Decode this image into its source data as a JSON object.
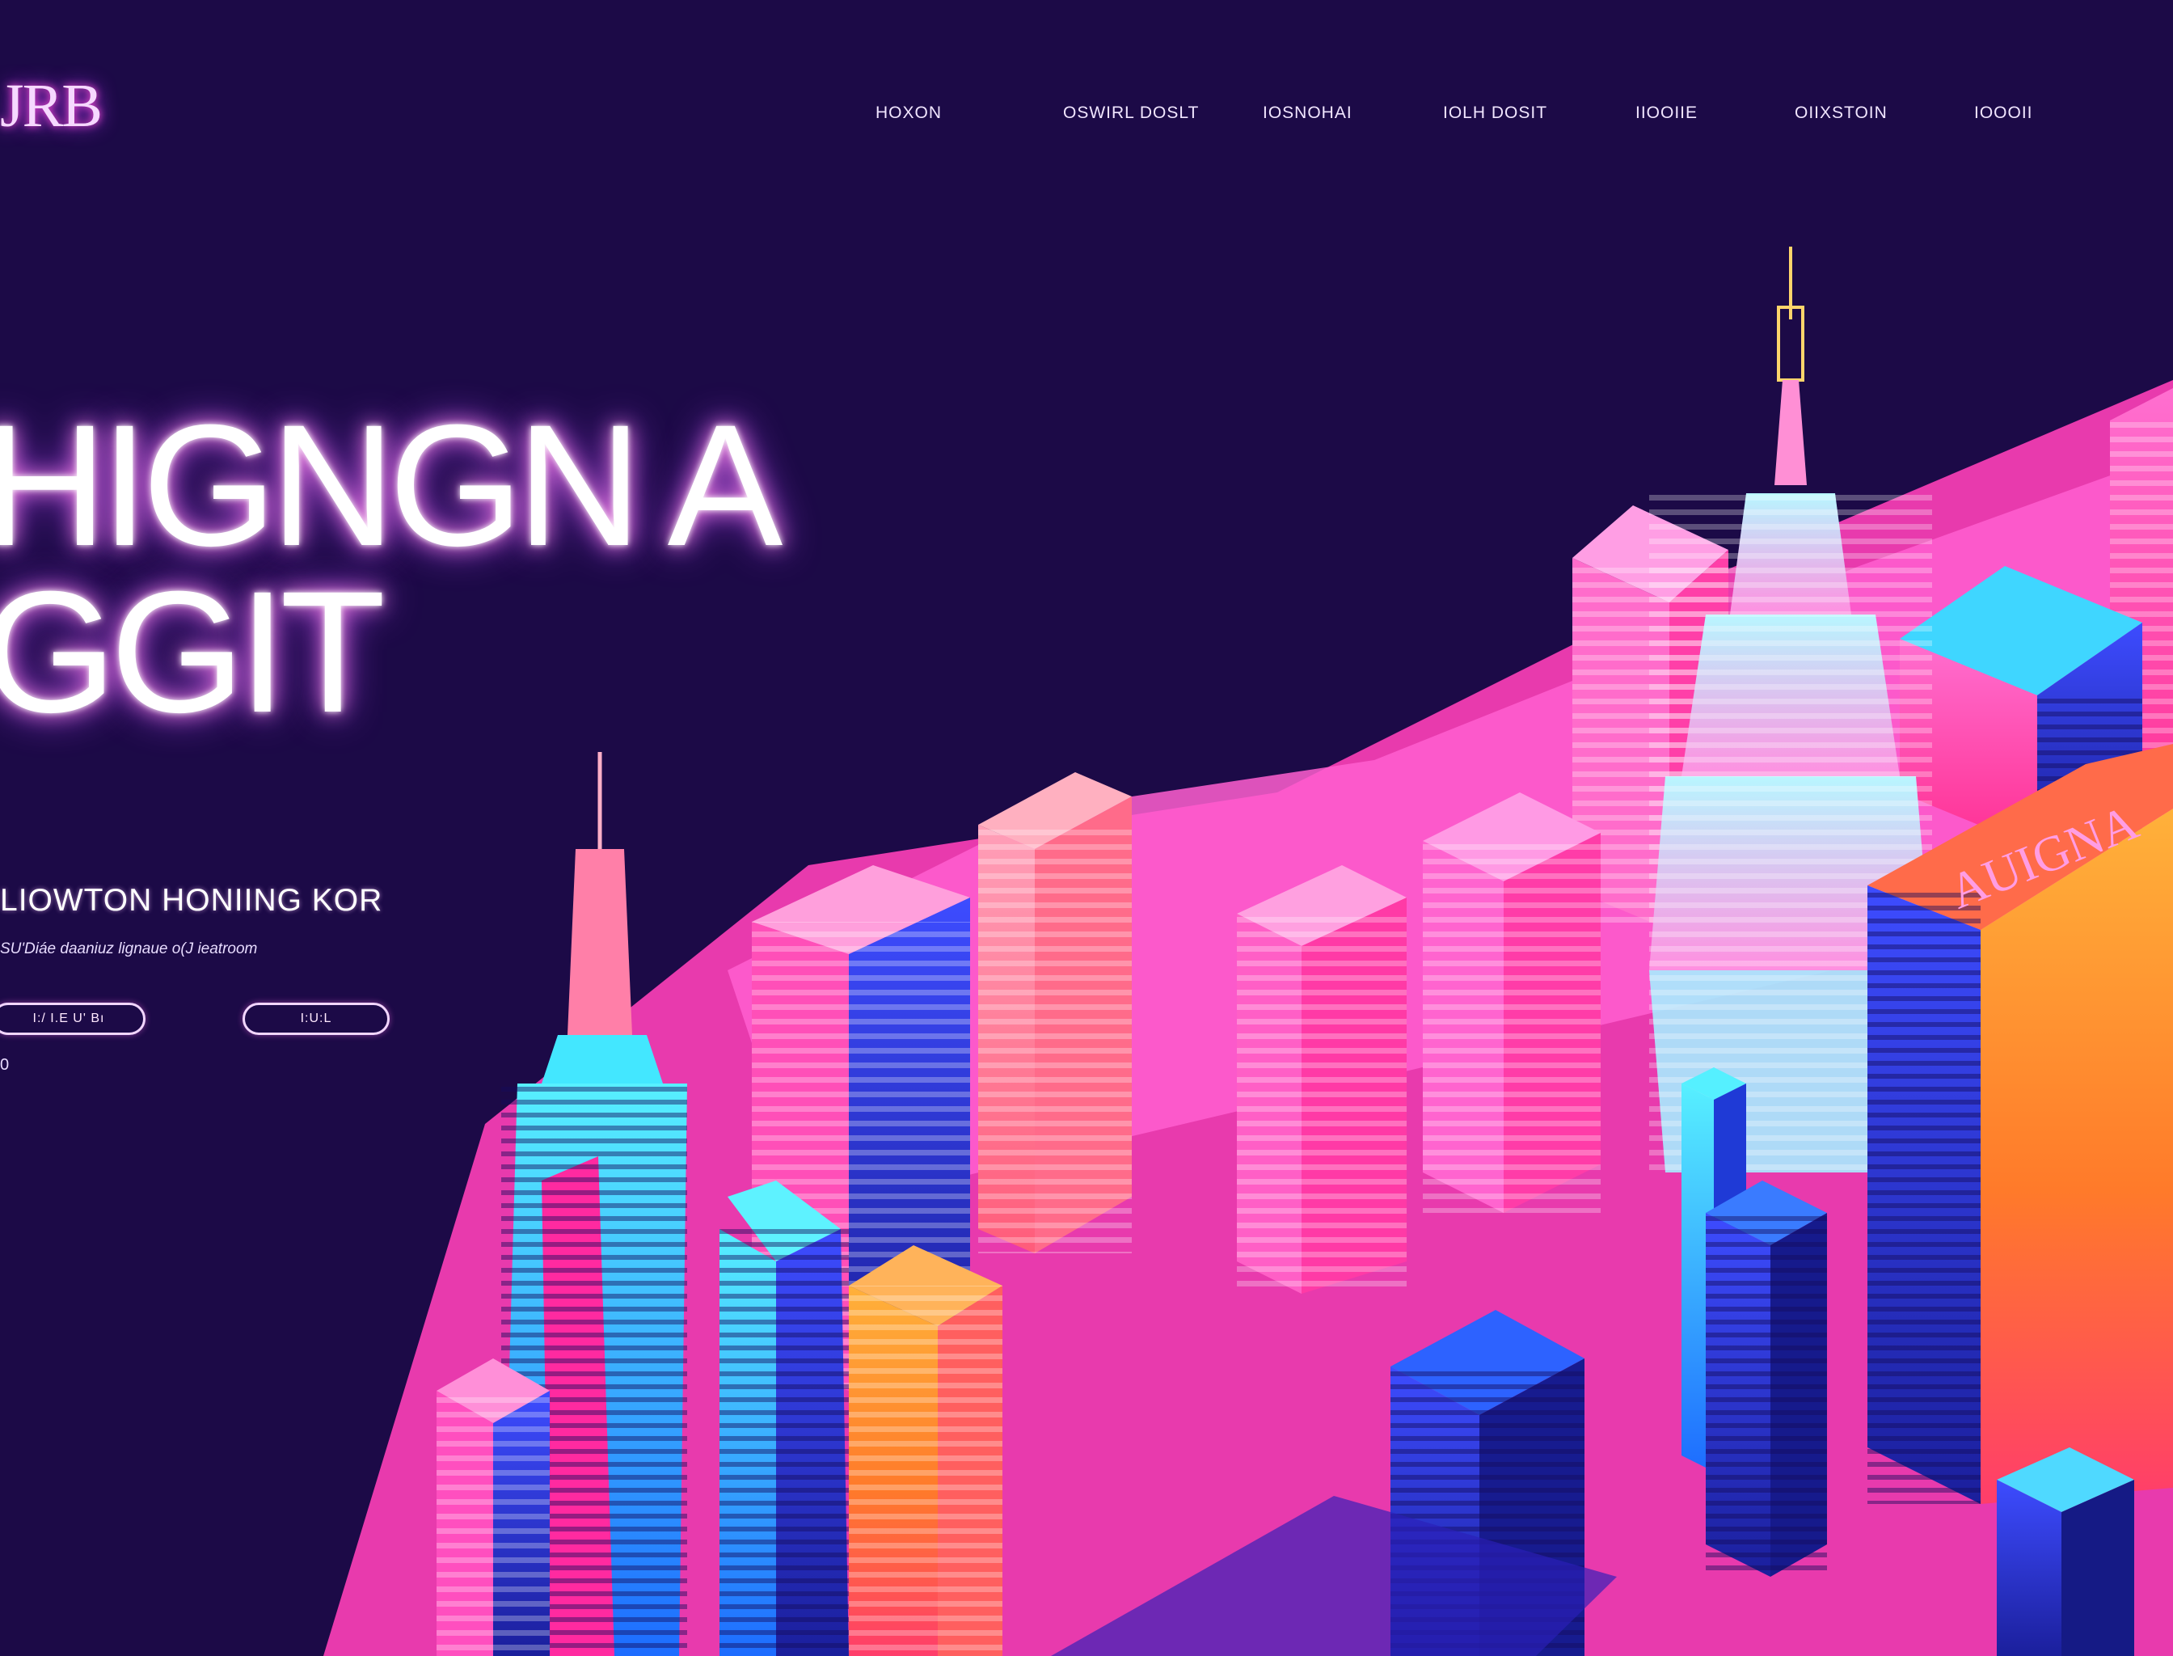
{
  "header": {
    "logo": "JRB",
    "nav": [
      "HOXON",
      "OSWIRL DOSLT",
      "IOSNOHAI",
      "IOLH DOSIT",
      "IIOOIIE",
      "OIIXSTOIN",
      "IOOOII"
    ]
  },
  "hero": {
    "title_line1": "HIGNGN A",
    "title_line2": "GGIT",
    "subtitle": "LIOWTON HONIING KOR",
    "description": "SU'Diáe daaniuz  lignaue  o(J ieatroom",
    "primary_button": "I:/ I.E  U' Bı",
    "secondary_button": "I:U:L",
    "note": "0"
  },
  "illustration": {
    "sign_text": "AUIGNA",
    "colors": {
      "background": "#1c0a47",
      "pink": "#ff2fb0",
      "magenta": "#ff5fd6",
      "cyan": "#41e6ff",
      "blue": "#2a36d6",
      "orange": "#ff8a2a"
    }
  }
}
